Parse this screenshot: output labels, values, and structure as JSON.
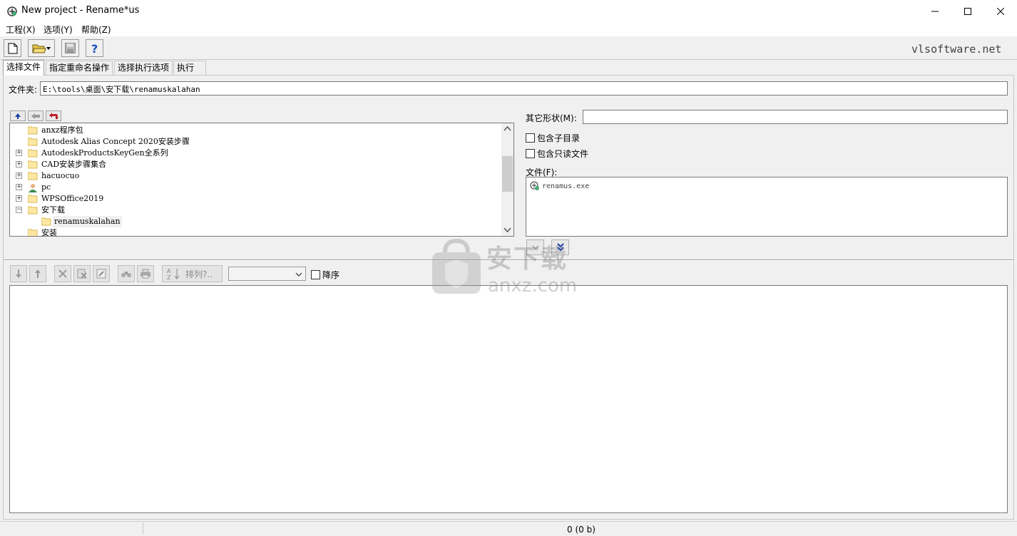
{
  "window": {
    "title": "New project - Rename*us"
  },
  "menu": {
    "items": [
      "工程(X)",
      "选项(Y)",
      "帮助(Z)"
    ]
  },
  "toolbar": {
    "site": "vlsoftware.net"
  },
  "tabs": [
    "选择文件",
    "指定重命名操作",
    "选择执行选项",
    "执行"
  ],
  "folder": {
    "label": "文件夹:",
    "value": "E:\\tools\\桌面\\安下载\\renamuskalahan"
  },
  "tree": {
    "items": [
      {
        "label": "anxz程序包",
        "expander": ""
      },
      {
        "label": "Autodesk Alias Concept 2020安装步骤",
        "expander": ""
      },
      {
        "label": "AutodeskProductsKeyGen全系列",
        "expander": "+"
      },
      {
        "label": "CAD安装步骤集合",
        "expander": "+"
      },
      {
        "label": "hacuocuo",
        "expander": "+"
      },
      {
        "label": "pc",
        "expander": "+"
      },
      {
        "label": "WPSOffice2019",
        "expander": "+"
      },
      {
        "label": "安下载",
        "expander": "−"
      },
      {
        "label": "renamuskalahan",
        "expander": ""
      },
      {
        "label": "安装",
        "expander": ""
      }
    ]
  },
  "right": {
    "other_label": "其它形状(M):",
    "include_sub": "包含子目录",
    "include_readonly": "包含只读文件",
    "files_label": "文件(F):",
    "files": [
      "renamus.exe"
    ]
  },
  "bottom": {
    "sort_label": "排列?..",
    "desc_label": "降序"
  },
  "status": {
    "text": "0  (0 b)"
  },
  "watermark": {
    "text": "安下载",
    "sub": "anxz.com"
  }
}
